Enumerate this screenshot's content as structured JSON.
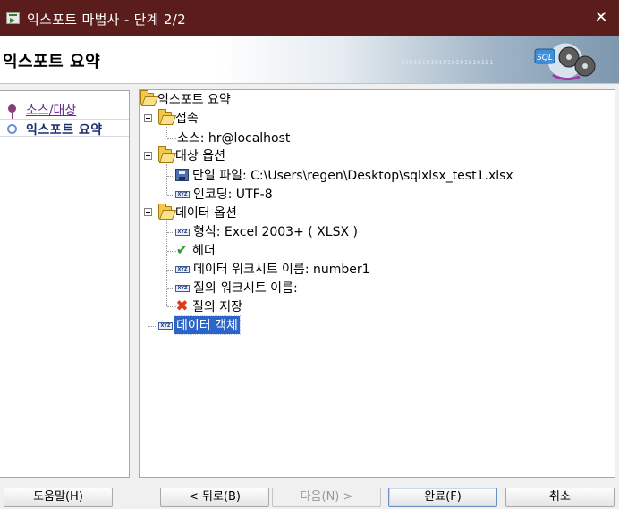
{
  "window": {
    "title": "익스포트 마법사 - 단계 2/2",
    "close_glyph": "✕"
  },
  "header": {
    "page_title": "익스포트 요약",
    "binary_text": "0101010101010101010101",
    "logo_text": "SQL"
  },
  "nav": {
    "items": [
      {
        "label": "소스/대상",
        "state": "done"
      },
      {
        "label": "익스포트 요약",
        "state": "current"
      }
    ]
  },
  "tree": {
    "root": "익스포트 요약",
    "connection": {
      "label": "접속",
      "source": "소스: hr@localhost"
    },
    "target_options": {
      "label": "대상 옵션",
      "single_file": "단일 파일: C:\\Users\\regen\\Desktop\\sqlxlsx_test1.xlsx",
      "encoding": "인코딩: UTF-8"
    },
    "data_options": {
      "label": "데이터 옵션",
      "format": "형식: Excel 2003+ ( XLSX )",
      "header": "헤더",
      "data_sheet": "데이터 워크시트 이름: number1",
      "query_sheet": "질의 워크시트 이름:",
      "save_query": "질의 저장"
    },
    "data_objects": "데이터 객체"
  },
  "buttons": {
    "help": "도움말(H)",
    "back": "< 뒤로(B)",
    "next": "다음(N) >",
    "finish": "완료(F)",
    "cancel": "취소"
  },
  "colors": {
    "titlebar": "#5b1c1c",
    "selection": "#2c64c8",
    "nav_done": "#6b2b8c"
  }
}
